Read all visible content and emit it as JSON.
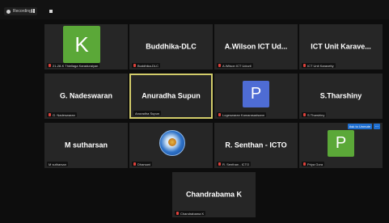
{
  "recording": {
    "label": "Recording...",
    "icon": "recording-icon"
  },
  "tiles": [
    {
      "name": "",
      "label": "21-28-K Thiellaga Karaduraiyan",
      "avatar_letter": "K",
      "avatar_color": "#5ba838"
    },
    {
      "name": "Buddhika-DLC",
      "label": "Buddhika-DLC"
    },
    {
      "name": "A.Wilson ICT Ud...",
      "label": "A.Wilson ICT Uduvil"
    },
    {
      "name": "ICT Unit Karave...",
      "label": "ICT Unit Karavetty"
    },
    {
      "name": "G. Nadeswaran",
      "label": "G. Nadeswaran"
    },
    {
      "name": "Anuradha Supun",
      "label": "Anuradha Supun",
      "active": true
    },
    {
      "name": "",
      "label": "Logeswaran Kamarasadsann",
      "avatar_letter": "P",
      "avatar_color": "#4e6cd4"
    },
    {
      "name": "S.Tharshiny",
      "label": "S.Tharshiny"
    },
    {
      "name": "M sutharsan",
      "label": "M sutharsan"
    },
    {
      "name": "",
      "label": "Dharsani",
      "avatar_icon": "globe-icon"
    },
    {
      "name": "R. Senthan - ICTO",
      "label": "R. Senthan - ICTO"
    },
    {
      "name": "",
      "label": "Priya Gora",
      "avatar_letter": "P",
      "avatar_color": "#5ba838",
      "pin_label": "Ask to Unmute",
      "more_label": "..."
    },
    {
      "name": "Chandrabama K",
      "label": "Chandrabama K"
    }
  ]
}
